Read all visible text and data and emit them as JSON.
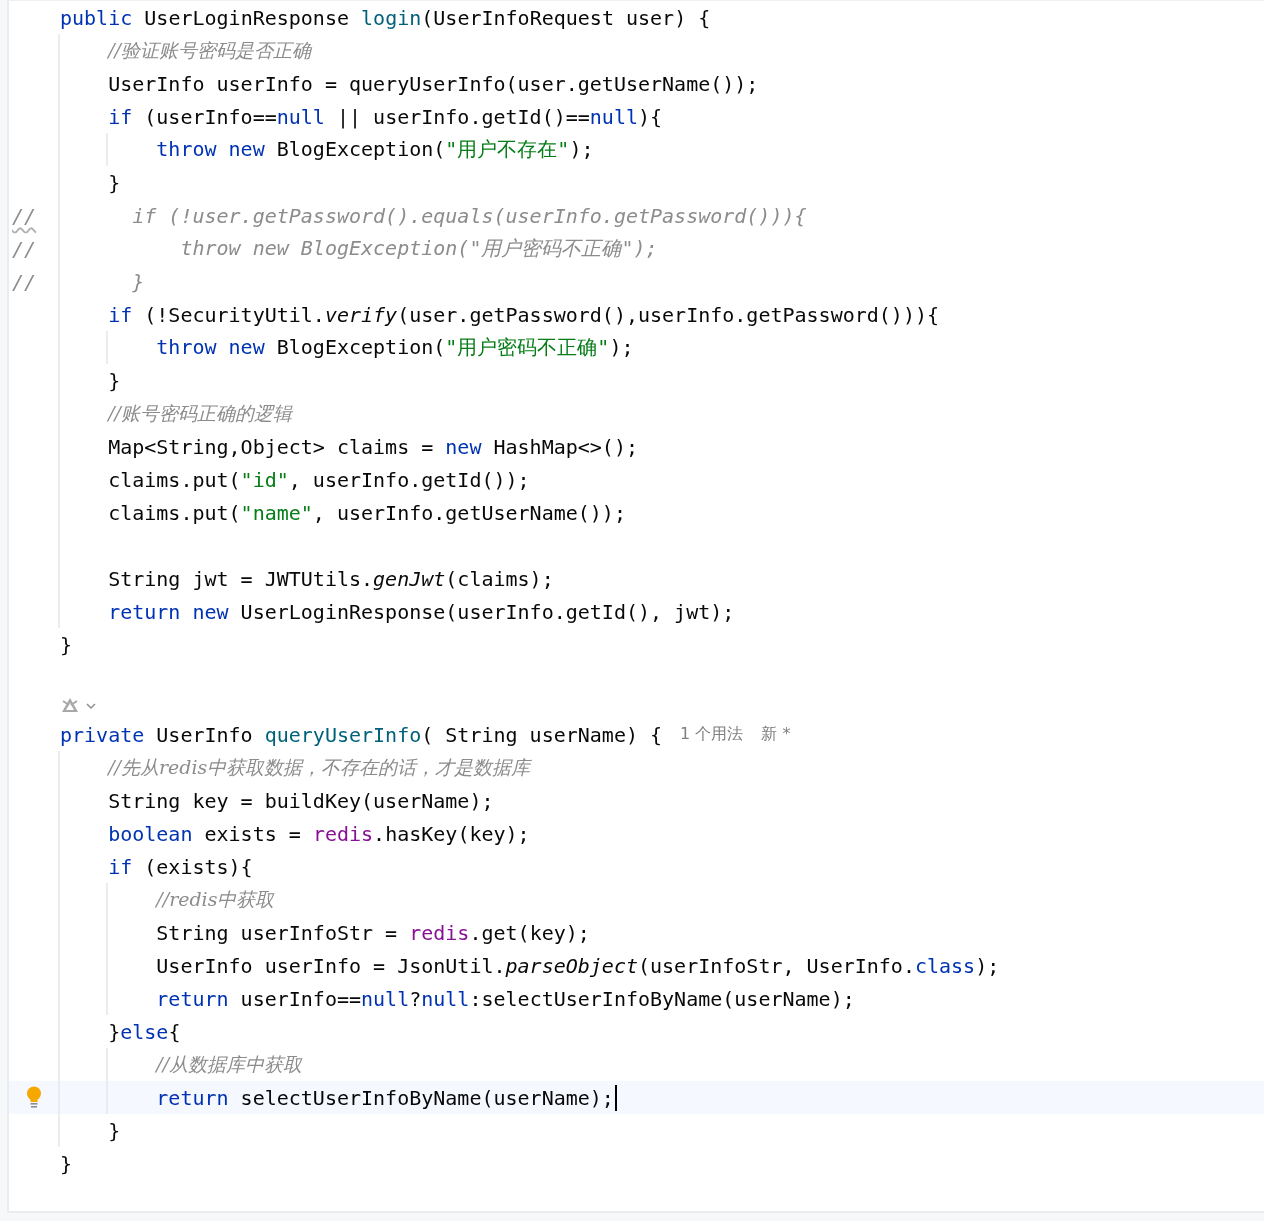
{
  "editor": {
    "lines": [
      {
        "kind": "code",
        "tokens": [
          {
            "kind": "keyword",
            "s": "public "
          },
          {
            "kind": "plain",
            "s": "UserLoginResponse "
          },
          {
            "kind": "declaration",
            "s": "login"
          },
          {
            "kind": "plain",
            "s": "(UserInfoRequest user) {"
          }
        ],
        "children": [
          {
            "kind": "code",
            "tokens": [
              {
                "kind": "comment",
                "s": "//验证账号密码是否正确"
              }
            ]
          },
          {
            "kind": "code",
            "tokens": [
              {
                "kind": "plain",
                "s": "UserInfo userInfo = queryUserInfo(user.getUserName());"
              }
            ]
          },
          {
            "kind": "code",
            "tokens": [
              {
                "kind": "keyword",
                "s": "if"
              },
              {
                "kind": "plain",
                "s": " (userInfo=="
              },
              {
                "kind": "keyword",
                "s": "null"
              },
              {
                "kind": "plain",
                "s": " || userInfo.getId()=="
              },
              {
                "kind": "keyword",
                "s": "null"
              },
              {
                "kind": "plain",
                "s": "){"
              }
            ],
            "children": [
              {
                "kind": "code",
                "tokens": [
                  {
                    "kind": "keyword",
                    "s": "throw new"
                  },
                  {
                    "kind": "plain",
                    "s": " BlogException("
                  },
                  {
                    "kind": "string",
                    "s": "\"用户不存在\""
                  },
                  {
                    "kind": "plain",
                    "s": ");"
                  }
                ]
              }
            ]
          },
          {
            "kind": "code",
            "tokens": [
              {
                "kind": "plain",
                "s": "}"
              }
            ]
          },
          {
            "kind": "code",
            "gutter": "//",
            "warning": true,
            "tokens": [
              {
                "kind": "disabled",
                "s": "  if (!user.getPassword().equals(userInfo.getPassword())){"
              }
            ]
          },
          {
            "kind": "code",
            "gutter": "//",
            "warning": false,
            "tokens": [
              {
                "kind": "disabled",
                "s": "      throw new BlogException(\"用户密码不正确\");"
              }
            ]
          },
          {
            "kind": "code",
            "gutter": "//",
            "warning": false,
            "tokens": [
              {
                "kind": "disabled",
                "s": "  }"
              }
            ]
          },
          {
            "kind": "code",
            "tokens": [
              {
                "kind": "keyword",
                "s": "if"
              },
              {
                "kind": "plain",
                "s": " (!SecurityUtil."
              },
              {
                "kind": "static-call",
                "s": "verify"
              },
              {
                "kind": "plain",
                "s": "(user.getPassword(),userInfo.getPassword())){"
              }
            ],
            "children": [
              {
                "kind": "code",
                "tokens": [
                  {
                    "kind": "keyword",
                    "s": "throw new"
                  },
                  {
                    "kind": "plain",
                    "s": " BlogException("
                  },
                  {
                    "kind": "string",
                    "s": "\"用户密码不正确\""
                  },
                  {
                    "kind": "plain",
                    "s": ");"
                  }
                ]
              }
            ]
          },
          {
            "kind": "code",
            "tokens": [
              {
                "kind": "plain",
                "s": "}"
              }
            ]
          },
          {
            "kind": "code",
            "tokens": [
              {
                "kind": "comment",
                "s": "//账号密码正确的逻辑"
              }
            ]
          },
          {
            "kind": "code",
            "tokens": [
              {
                "kind": "plain",
                "s": "Map<String,Object> claims = "
              },
              {
                "kind": "keyword",
                "s": "new"
              },
              {
                "kind": "plain",
                "s": " HashMap<>();"
              }
            ]
          },
          {
            "kind": "code",
            "tokens": [
              {
                "kind": "plain",
                "s": "claims.put("
              },
              {
                "kind": "string",
                "s": "\"id\""
              },
              {
                "kind": "plain",
                "s": ", userInfo.getId());"
              }
            ]
          },
          {
            "kind": "code",
            "tokens": [
              {
                "kind": "plain",
                "s": "claims.put("
              },
              {
                "kind": "string",
                "s": "\"name\""
              },
              {
                "kind": "plain",
                "s": ", userInfo.getUserName());"
              }
            ]
          },
          {
            "kind": "blank"
          },
          {
            "kind": "code",
            "tokens": [
              {
                "kind": "plain",
                "s": "String jwt = JWTUtils."
              },
              {
                "kind": "static-call",
                "s": "genJwt"
              },
              {
                "kind": "plain",
                "s": "(claims);"
              }
            ]
          },
          {
            "kind": "code",
            "tokens": [
              {
                "kind": "keyword",
                "s": "return new"
              },
              {
                "kind": "plain",
                "s": " UserLoginResponse(userInfo.getId(), jwt);"
              }
            ]
          }
        ]
      },
      {
        "kind": "code",
        "tokens": [
          {
            "kind": "plain",
            "s": "}"
          }
        ]
      },
      {
        "kind": "blank"
      },
      {
        "kind": "marker"
      },
      {
        "kind": "code",
        "tokens": [
          {
            "kind": "keyword",
            "s": "private "
          },
          {
            "kind": "plain",
            "s": "UserInfo "
          },
          {
            "kind": "declaration",
            "s": "queryUserInfo"
          },
          {
            "kind": "plain",
            "s": "( String userName) {"
          }
        ],
        "hints": [
          "1 个用法",
          "新 *"
        ],
        "children": [
          {
            "kind": "code",
            "tokens": [
              {
                "kind": "comment",
                "s": "//先从redis中获取数据，不存在的话，才是数据库"
              }
            ]
          },
          {
            "kind": "code",
            "tokens": [
              {
                "kind": "plain",
                "s": "String key = buildKey(userName);"
              }
            ]
          },
          {
            "kind": "code",
            "tokens": [
              {
                "kind": "keyword",
                "s": "boolean"
              },
              {
                "kind": "plain",
                "s": " exists = "
              },
              {
                "kind": "field",
                "s": "redis"
              },
              {
                "kind": "plain",
                "s": ".hasKey(key);"
              }
            ]
          },
          {
            "kind": "code",
            "tokens": [
              {
                "kind": "keyword",
                "s": "if"
              },
              {
                "kind": "plain",
                "s": " (exists){"
              }
            ],
            "children": [
              {
                "kind": "code",
                "tokens": [
                  {
                    "kind": "comment",
                    "s": "//redis中获取"
                  }
                ]
              },
              {
                "kind": "code",
                "tokens": [
                  {
                    "kind": "plain",
                    "s": "String userInfoStr = "
                  },
                  {
                    "kind": "field",
                    "s": "redis"
                  },
                  {
                    "kind": "plain",
                    "s": ".get(key);"
                  }
                ]
              },
              {
                "kind": "code",
                "tokens": [
                  {
                    "kind": "plain",
                    "s": "UserInfo userInfo = JsonUtil."
                  },
                  {
                    "kind": "static-call",
                    "s": "parseObject"
                  },
                  {
                    "kind": "plain",
                    "s": "(userInfoStr, UserInfo."
                  },
                  {
                    "kind": "keyword",
                    "s": "class"
                  },
                  {
                    "kind": "plain",
                    "s": ");"
                  }
                ]
              },
              {
                "kind": "code",
                "tokens": [
                  {
                    "kind": "keyword",
                    "s": "return"
                  },
                  {
                    "kind": "plain",
                    "s": " userInfo=="
                  },
                  {
                    "kind": "keyword",
                    "s": "null"
                  },
                  {
                    "kind": "plain",
                    "s": "?"
                  },
                  {
                    "kind": "keyword",
                    "s": "null"
                  },
                  {
                    "kind": "plain",
                    "s": ":selectUserInfoByName(userName);"
                  }
                ]
              }
            ]
          },
          {
            "kind": "code",
            "tokens": [
              {
                "kind": "plain",
                "s": "}"
              },
              {
                "kind": "keyword",
                "s": "else"
              },
              {
                "kind": "plain",
                "s": "{"
              }
            ],
            "children": [
              {
                "kind": "code",
                "tokens": [
                  {
                    "kind": "comment",
                    "s": "//从数据库中获取"
                  }
                ]
              },
              {
                "kind": "code",
                "current": true,
                "bulb": true,
                "caret": true,
                "tokens": [
                  {
                    "kind": "keyword",
                    "s": "return"
                  },
                  {
                    "kind": "plain",
                    "s": " selectUserInfoByName(userName);"
                  }
                ]
              }
            ]
          },
          {
            "kind": "code",
            "tokens": [
              {
                "kind": "plain",
                "s": "}"
              }
            ]
          }
        ]
      },
      {
        "kind": "code",
        "tokens": [
          {
            "kind": "plain",
            "s": "}"
          }
        ]
      }
    ]
  }
}
